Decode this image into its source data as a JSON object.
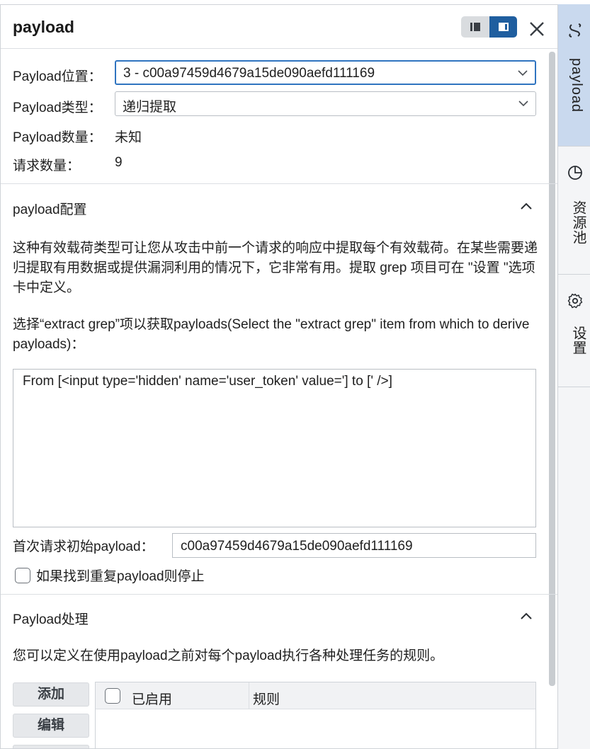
{
  "panel": {
    "title": "payload",
    "close_icon": "close-icon",
    "view_toggle": {
      "left_icon": "list-layout-icon",
      "right_icon": "split-layout-icon"
    }
  },
  "position_row": {
    "label": "Payload位置：",
    "value": "3 - c00a97459d4679a15de090aefd111169"
  },
  "type_row": {
    "label": "Payload类型：",
    "value": "递归提取"
  },
  "count_row": {
    "label": "Payload数量：",
    "value": "未知"
  },
  "requests_row": {
    "label": "请求数量：",
    "value": "9"
  },
  "config_section": {
    "title": "payload配置",
    "description": "这种有效载荷类型可让您从攻击中前一个请求的响应中提取每个有效载荷。在某些需要递归提取有用数据或提供漏洞利用的情况下，它非常有用。提取 grep 项目可在 \"设置 \"选项卡中定义。",
    "select_prompt": "选择“extract grep”项以获取payloads(Select the \"extract grep\" item from which to derive payloads)：",
    "grep_item": "From [<input type='hidden' name='user_token' value='] to [' />]",
    "initial_payload_label": "首次请求初始payload：",
    "initial_payload_value": "c00a97459d4679a15de090aefd111169",
    "stop_on_duplicate_label": "如果找到重复payload则停止",
    "stop_on_duplicate_checked": false
  },
  "processing_section": {
    "title": "Payload处理",
    "description": "您可以定义在使用payload之前对每个payload执行各种处理任务的规则。",
    "buttons": {
      "add": "添加",
      "edit": "编辑"
    },
    "table": {
      "col_enabled": "已启用",
      "col_rule": "规则"
    }
  },
  "dock": {
    "tabs": [
      {
        "label": "payload",
        "icon": "payload-icon",
        "active": true
      },
      {
        "label": "资源池",
        "icon": "resource-pool-icon",
        "active": false
      },
      {
        "label": "设置",
        "icon": "gear-icon",
        "active": false
      }
    ]
  },
  "colors": {
    "accent": "#1f5e9f",
    "dock_active": "#c9d9ee"
  }
}
